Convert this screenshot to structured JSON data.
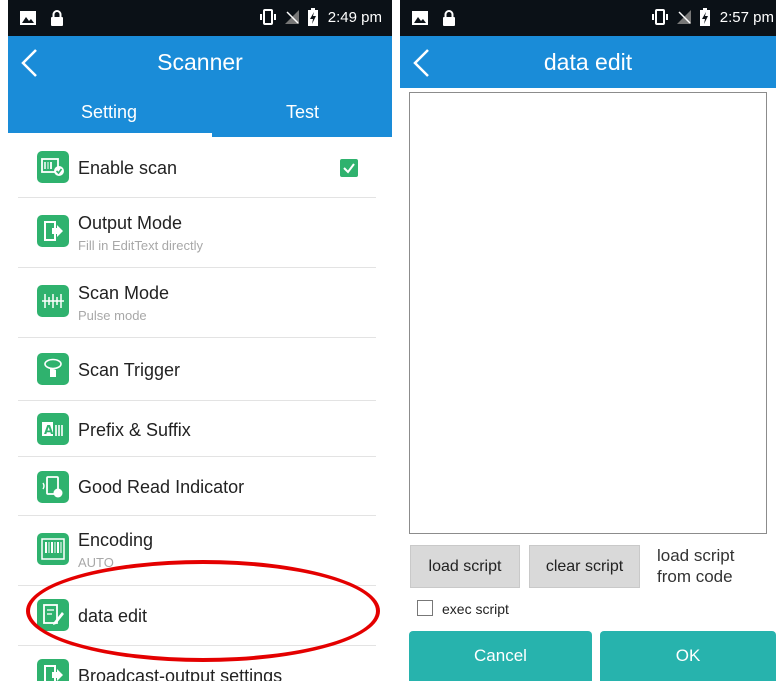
{
  "left_screen": {
    "status_bar": {
      "time": "2:49 pm"
    },
    "app_bar": {
      "title": "Scanner",
      "back_icon": "chevron-left-icon"
    },
    "tabs": [
      {
        "label": "Setting",
        "selected": true
      },
      {
        "label": "Test",
        "selected": false
      }
    ],
    "items": [
      {
        "label": "Enable scan",
        "subtitle": "",
        "icon": "barcode-check-icon",
        "checked": true
      },
      {
        "label": "Output Mode",
        "subtitle": "Fill in EditText directly",
        "icon": "output-arrow-icon"
      },
      {
        "label": "Scan Mode",
        "subtitle": "Pulse mode",
        "icon": "scan-mode-icon"
      },
      {
        "label": "Scan Trigger",
        "subtitle": "",
        "icon": "hand-trigger-icon"
      },
      {
        "label": "Prefix & Suffix",
        "subtitle": "",
        "icon": "prefix-suffix-icon"
      },
      {
        "label": "Good Read Indicator",
        "subtitle": "",
        "icon": "good-read-indicator-icon"
      },
      {
        "label": "Encoding",
        "subtitle": "AUTO",
        "icon": "encoding-barcode-icon"
      },
      {
        "label": "data edit",
        "subtitle": "",
        "icon": "data-edit-icon"
      },
      {
        "label": "Broadcast-output settings",
        "subtitle": "",
        "icon": "broadcast-output-icon"
      }
    ],
    "annotation_color": "#e40000"
  },
  "right_screen": {
    "status_bar": {
      "time": "2:57 pm"
    },
    "app_bar": {
      "title": "data edit",
      "back_icon": "chevron-left-icon"
    },
    "editor_value": "",
    "buttons": {
      "load_script": "load script",
      "clear_script": "clear script",
      "load_from_code_line1": "load script",
      "load_from_code_line2": "from code"
    },
    "exec_script_label": "exec script",
    "exec_script_checked": false,
    "dialog_buttons": {
      "cancel": "Cancel",
      "ok": "OK"
    }
  },
  "colors": {
    "primary": "#1a8cd8",
    "icon_green": "#2fb26e",
    "teal_button": "#27b3ad",
    "status_bar": "#0b1117"
  }
}
